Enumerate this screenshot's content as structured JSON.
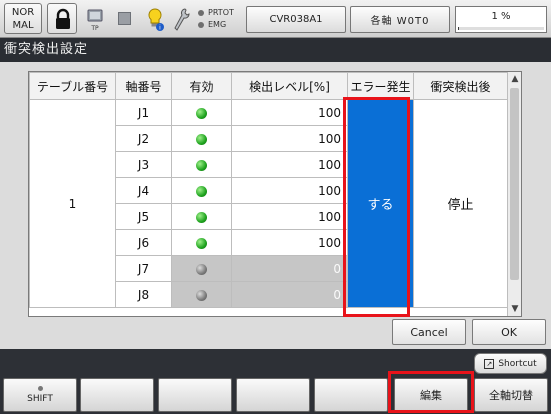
{
  "status_bar": {
    "mode_line1": "NOR",
    "mode_line2": "MAL",
    "tp_label": "TP",
    "lamp_prtot": "PRTOT",
    "lamp_emg": "EMG",
    "job_name": "CVR038A1",
    "axis_mode": "各軸 W0T0",
    "speed_text": "1 %",
    "speed_percent": 1
  },
  "title": "衝突検出設定",
  "table": {
    "headers": [
      "テーブル番号",
      "軸番号",
      "有効",
      "検出レベル[%]",
      "エラー発生",
      "衝突検出後"
    ],
    "table_number": "1",
    "error_value": "する",
    "after_value": "停止",
    "rows": [
      {
        "axis": "J1",
        "enabled": true,
        "level": "100"
      },
      {
        "axis": "J2",
        "enabled": true,
        "level": "100"
      },
      {
        "axis": "J3",
        "enabled": true,
        "level": "100"
      },
      {
        "axis": "J4",
        "enabled": true,
        "level": "100"
      },
      {
        "axis": "J5",
        "enabled": true,
        "level": "100"
      },
      {
        "axis": "J6",
        "enabled": true,
        "level": "100"
      },
      {
        "axis": "J7",
        "enabled": false,
        "level": "0"
      },
      {
        "axis": "J8",
        "enabled": false,
        "level": "0"
      }
    ]
  },
  "buttons": {
    "cancel": "Cancel",
    "ok": "OK",
    "shortcut": "Shortcut"
  },
  "soft_keys": {
    "shift": "SHIFT",
    "f6": "編集",
    "f7": "全軸切替"
  },
  "colors": {
    "error_cell": "#0a6fd6",
    "highlight": "#e8131a",
    "led_on": "#1fa31f"
  }
}
